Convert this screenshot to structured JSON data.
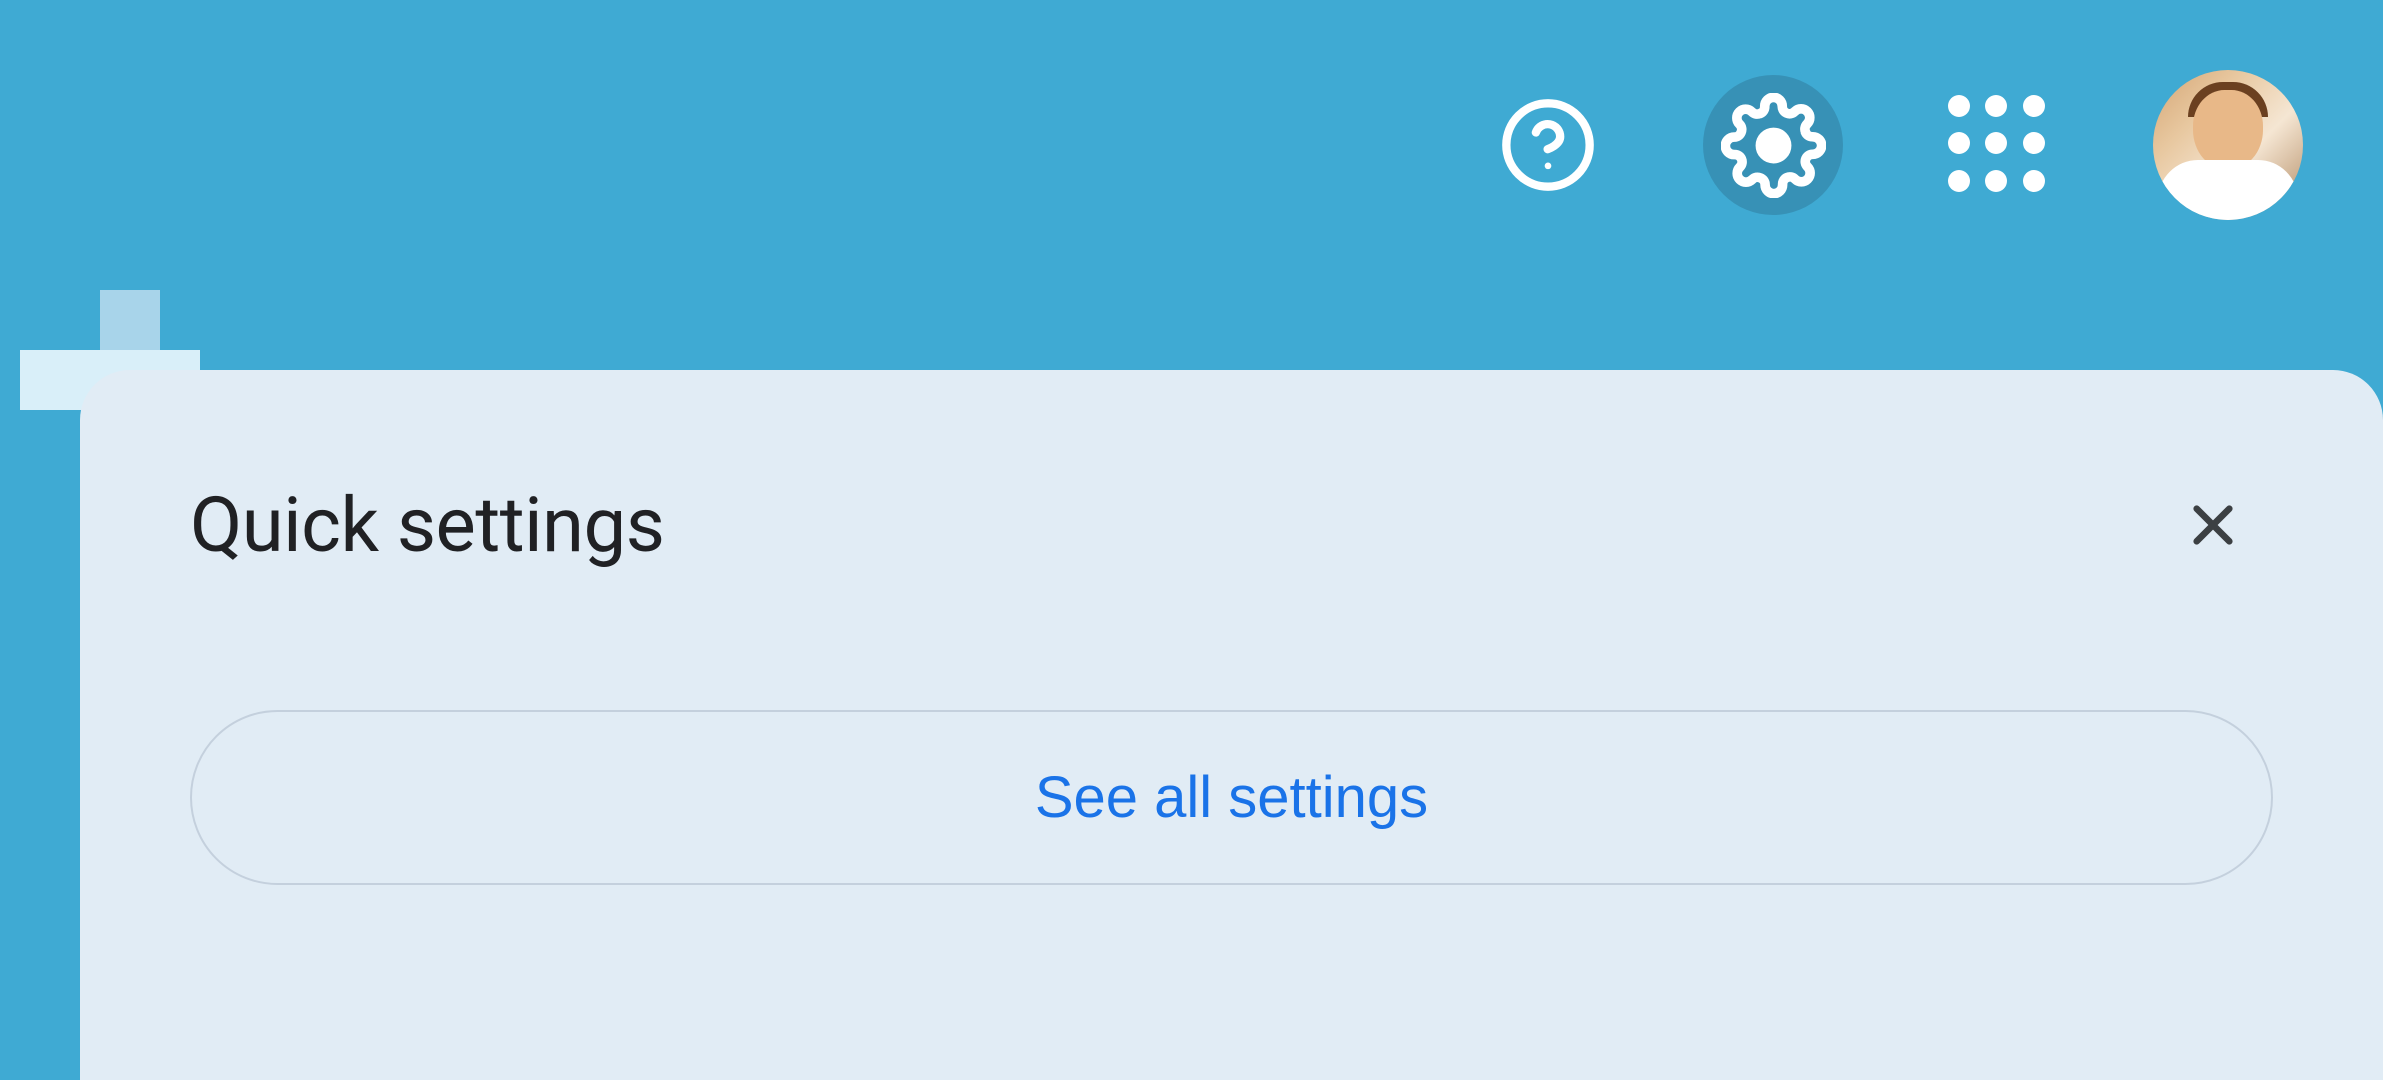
{
  "header": {
    "help_icon": "help-icon",
    "settings_icon": "gear-icon",
    "apps_icon": "apps-icon",
    "avatar": "user-avatar"
  },
  "panel": {
    "title": "Quick settings",
    "close_icon": "close-icon",
    "see_all_label": "See all settings"
  }
}
